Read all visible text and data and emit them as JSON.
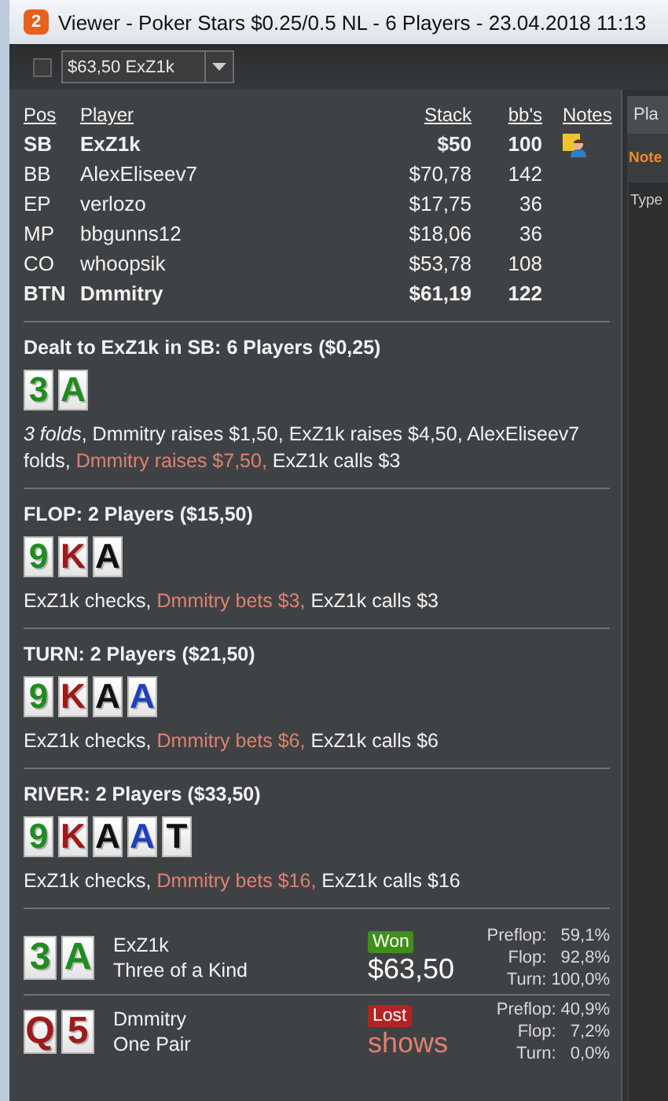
{
  "window": {
    "app_icon_label": "2",
    "title": "Viewer - Poker Stars $0.25/0.5 NL - 6 Players - 23.04.2018 11:13"
  },
  "toolbar": {
    "checked": false,
    "hand_select": "$63,50 ExZ1k"
  },
  "seats": {
    "columns": [
      "Pos",
      "Player",
      "Stack",
      "bb's",
      "Notes"
    ],
    "rows": [
      {
        "pos": "SB",
        "player": "ExZ1k",
        "stack": "$50",
        "bbs": "100",
        "bold": true,
        "has_note": true
      },
      {
        "pos": "BB",
        "player": "AlexEliseev7",
        "stack": "$70,78",
        "bbs": "142",
        "bold": false,
        "has_note": false
      },
      {
        "pos": "EP",
        "player": "verlozo",
        "stack": "$17,75",
        "bbs": "36",
        "bold": false,
        "has_note": false
      },
      {
        "pos": "MP",
        "player": "bbgunns12",
        "stack": "$18,06",
        "bbs": "36",
        "bold": false,
        "has_note": false
      },
      {
        "pos": "CO",
        "player": "whoopsik",
        "stack": "$53,78",
        "bbs": "108",
        "bold": false,
        "has_note": false
      },
      {
        "pos": "BTN",
        "player": "Dmmitry",
        "stack": "$61,19",
        "bbs": "122",
        "bold": true,
        "has_note": false
      }
    ]
  },
  "streets": [
    {
      "title": "Dealt to ExZ1k in SB: 6 Players ($0,25)",
      "cards": [
        {
          "rank": "3",
          "color": "#1e8c1e"
        },
        {
          "rank": "A",
          "color": "#1e8c1e"
        }
      ],
      "actions": [
        {
          "kind": "italic",
          "text": "3 folds"
        },
        {
          "kind": "plain",
          "text": ", Dmmitry raises $1,50, ExZ1k raises $4,50, AlexEliseev7 folds, "
        },
        {
          "kind": "aggressor",
          "text": "Dmmitry raises $7,50,"
        },
        {
          "kind": "plain",
          "text": " ExZ1k calls $3"
        }
      ]
    },
    {
      "title": "FLOP: 2 Players ($15,50)",
      "cards": [
        {
          "rank": "9",
          "color": "#1e8c1e"
        },
        {
          "rank": "K",
          "color": "#9e1a1a"
        },
        {
          "rank": "A",
          "color": "#111111"
        }
      ],
      "actions": [
        {
          "kind": "plain",
          "text": "ExZ1k checks, "
        },
        {
          "kind": "aggressor",
          "text": "Dmmitry bets $3,"
        },
        {
          "kind": "plain",
          "text": " ExZ1k calls $3"
        }
      ]
    },
    {
      "title": "TURN: 2 Players ($21,50)",
      "cards": [
        {
          "rank": "9",
          "color": "#1e8c1e"
        },
        {
          "rank": "K",
          "color": "#9e1a1a"
        },
        {
          "rank": "A",
          "color": "#111111"
        },
        {
          "rank": "A",
          "color": "#1f3fc0"
        }
      ],
      "actions": [
        {
          "kind": "plain",
          "text": "ExZ1k checks, "
        },
        {
          "kind": "aggressor",
          "text": "Dmmitry bets $6,"
        },
        {
          "kind": "plain",
          "text": " ExZ1k calls $6"
        }
      ]
    },
    {
      "title": "RIVER: 2 Players ($33,50)",
      "cards": [
        {
          "rank": "9",
          "color": "#1e8c1e"
        },
        {
          "rank": "K",
          "color": "#9e1a1a"
        },
        {
          "rank": "A",
          "color": "#111111"
        },
        {
          "rank": "A",
          "color": "#1f3fc0"
        },
        {
          "rank": "T",
          "color": "#111111"
        }
      ],
      "actions": [
        {
          "kind": "plain",
          "text": "ExZ1k checks, "
        },
        {
          "kind": "aggressor",
          "text": "Dmmitry bets $16,"
        },
        {
          "kind": "plain",
          "text": " ExZ1k calls $16"
        }
      ]
    }
  ],
  "results": [
    {
      "cards": [
        {
          "rank": "3",
          "color": "#1e8c1e"
        },
        {
          "rank": "A",
          "color": "#1e8c1e"
        }
      ],
      "player": "ExZ1k",
      "hand": "Three of a Kind",
      "kind": "won",
      "badge": "Won",
      "amount": "$63,50",
      "equity": [
        {
          "label": "Preflop:",
          "value": "59,1%"
        },
        {
          "label": "Flop:",
          "value": "92,8%"
        },
        {
          "label": "Turn:",
          "value": "100,0%"
        }
      ]
    },
    {
      "cards": [
        {
          "rank": "Q",
          "color": "#9e1a1a"
        },
        {
          "rank": "5",
          "color": "#9e1a1a"
        }
      ],
      "player": "Dmmitry",
      "hand": "One Pair",
      "kind": "lost",
      "badge": "Lost",
      "amount": "shows",
      "equity": [
        {
          "label": "Preflop:",
          "value": "40,9%"
        },
        {
          "label": "Flop:",
          "value": "7,2%"
        },
        {
          "label": "Turn:",
          "value": "0,0%"
        }
      ]
    }
  ],
  "side_panel": {
    "tab": "Pla",
    "notes_label": "Note",
    "notes_placeholder": "Type"
  }
}
